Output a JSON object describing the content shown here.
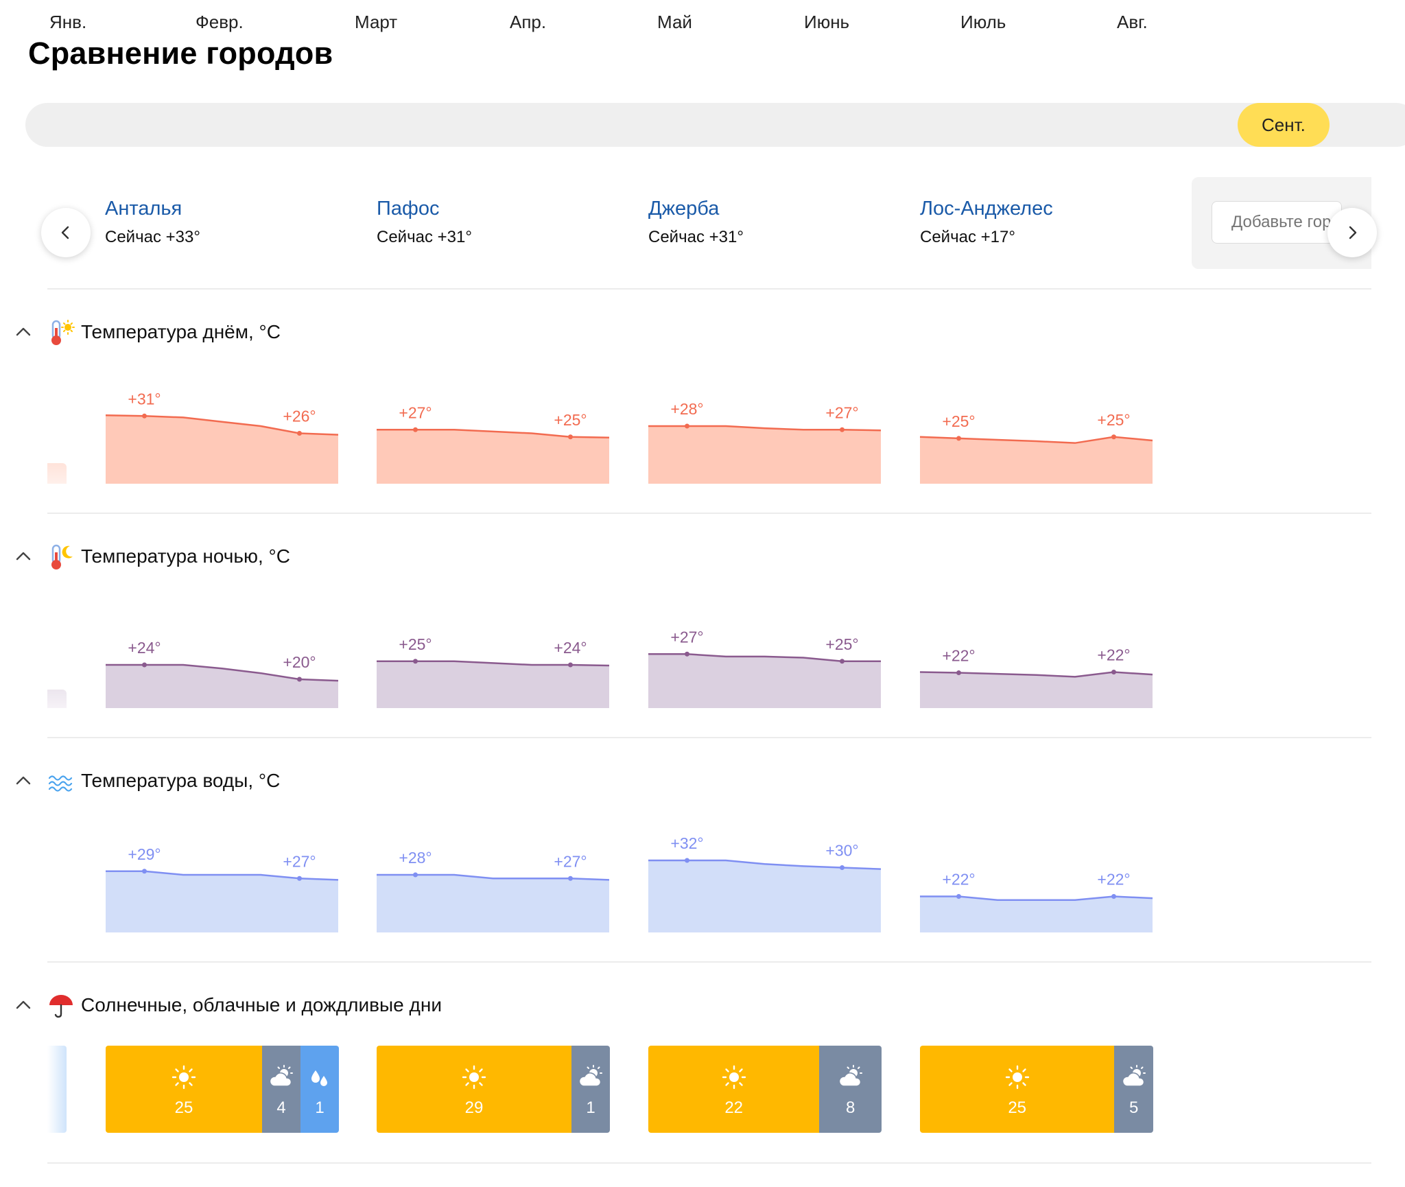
{
  "title": "Сравнение городов",
  "months": [
    {
      "label": "Янв.",
      "active": false
    },
    {
      "label": "Февр.",
      "active": false
    },
    {
      "label": "Март",
      "active": false
    },
    {
      "label": "Апр.",
      "active": false
    },
    {
      "label": "Май",
      "active": false
    },
    {
      "label": "Июнь",
      "active": false
    },
    {
      "label": "Июль",
      "active": false
    },
    {
      "label": "Авг.",
      "active": false
    },
    {
      "label": "Сент.",
      "active": true
    }
  ],
  "cities": [
    {
      "name": "Анталья",
      "now": "Сейчас +33°"
    },
    {
      "name": "Пафос",
      "now": "Сейчас +31°"
    },
    {
      "name": "Джерба",
      "now": "Сейчас +31°"
    },
    {
      "name": "Лос-Анджелес",
      "now": "Сейчас +17°"
    }
  ],
  "add_city": {
    "placeholder": "Добавьте город"
  },
  "sections": {
    "day": {
      "title": "Температура днём, °C",
      "icon": "thermometer-sun-icon"
    },
    "night": {
      "title": "Температура ночью, °C",
      "icon": "thermometer-moon-icon"
    },
    "water": {
      "title": "Температура воды, °C",
      "icon": "water-waves-icon"
    },
    "days": {
      "title": "Солнечные, облачные и дождливые дни",
      "icon": "umbrella-icon"
    }
  },
  "chart_data": [
    {
      "type": "area",
      "title": "Температура днём, °C",
      "color": "#f26b50",
      "fill": "#ffc9b8",
      "series": [
        {
          "name": "Анталья",
          "start_label": "+31°",
          "end_label": "+26°",
          "values": [
            31,
            30.8,
            30.4,
            29.2,
            28,
            26,
            25.6
          ]
        },
        {
          "name": "Пафос",
          "start_label": "+27°",
          "end_label": "+25°",
          "values": [
            27,
            27,
            27,
            26.5,
            26,
            25,
            24.8
          ]
        },
        {
          "name": "Джерба",
          "start_label": "+28°",
          "end_label": "+27°",
          "values": [
            28,
            28,
            28,
            27.4,
            27,
            27,
            26.8
          ]
        },
        {
          "name": "Лос-Анджелес",
          "start_label": "+25°",
          "end_label": "+25°",
          "values": [
            25,
            24.6,
            24.2,
            23.8,
            23.3,
            25,
            24
          ]
        }
      ]
    },
    {
      "type": "area",
      "title": "Температура ночью, °C",
      "color": "#8a5a8e",
      "fill": "#dbd0e0",
      "series": [
        {
          "name": "Анталья",
          "start_label": "+24°",
          "end_label": "+20°",
          "values": [
            24,
            24,
            24,
            23,
            21.7,
            20,
            19.6
          ]
        },
        {
          "name": "Пафос",
          "start_label": "+25°",
          "end_label": "+24°",
          "values": [
            25,
            25,
            25,
            24.5,
            24,
            24,
            23.8
          ]
        },
        {
          "name": "Джерба",
          "start_label": "+27°",
          "end_label": "+25°",
          "values": [
            27,
            27,
            26.3,
            26.3,
            26,
            25,
            25
          ]
        },
        {
          "name": "Лос-Анджелес",
          "start_label": "+22°",
          "end_label": "+22°",
          "values": [
            22,
            21.8,
            21.5,
            21.2,
            20.7,
            22,
            21.3
          ]
        }
      ]
    },
    {
      "type": "area",
      "title": "Температура воды, °C",
      "color": "#7f8ff2",
      "fill": "#d2def9",
      "series": [
        {
          "name": "Анталья",
          "start_label": "+29°",
          "end_label": "+27°",
          "values": [
            29,
            29,
            28,
            28,
            28,
            27,
            26.6
          ]
        },
        {
          "name": "Пафос",
          "start_label": "+28°",
          "end_label": "+27°",
          "values": [
            28,
            28,
            28,
            27,
            27,
            27,
            26.6
          ]
        },
        {
          "name": "Джерба",
          "start_label": "+32°",
          "end_label": "+30°",
          "values": [
            32,
            32,
            32,
            31,
            30.4,
            30,
            29.6
          ]
        },
        {
          "name": "Лос-Анджелес",
          "start_label": "+22°",
          "end_label": "+22°",
          "values": [
            22,
            22,
            21,
            21,
            21,
            22,
            21.5
          ]
        }
      ]
    },
    {
      "type": "bar",
      "title": "Солнечные, облачные и дождливые дни",
      "categories": [
        "Анталья",
        "Пафос",
        "Джерба",
        "Лос-Анджелес"
      ],
      "series": [
        {
          "name": "sunny",
          "icon": "sun-icon",
          "color": "#ffb800",
          "values": [
            25,
            29,
            22,
            25
          ]
        },
        {
          "name": "cloudy",
          "icon": "cloud-sun-icon",
          "color": "#7a8ba3",
          "values": [
            4,
            1,
            8,
            5
          ]
        },
        {
          "name": "rainy",
          "icon": "rain-drops-icon",
          "color": "#5ea2ee",
          "values": [
            1,
            0,
            0,
            0
          ]
        }
      ]
    }
  ]
}
